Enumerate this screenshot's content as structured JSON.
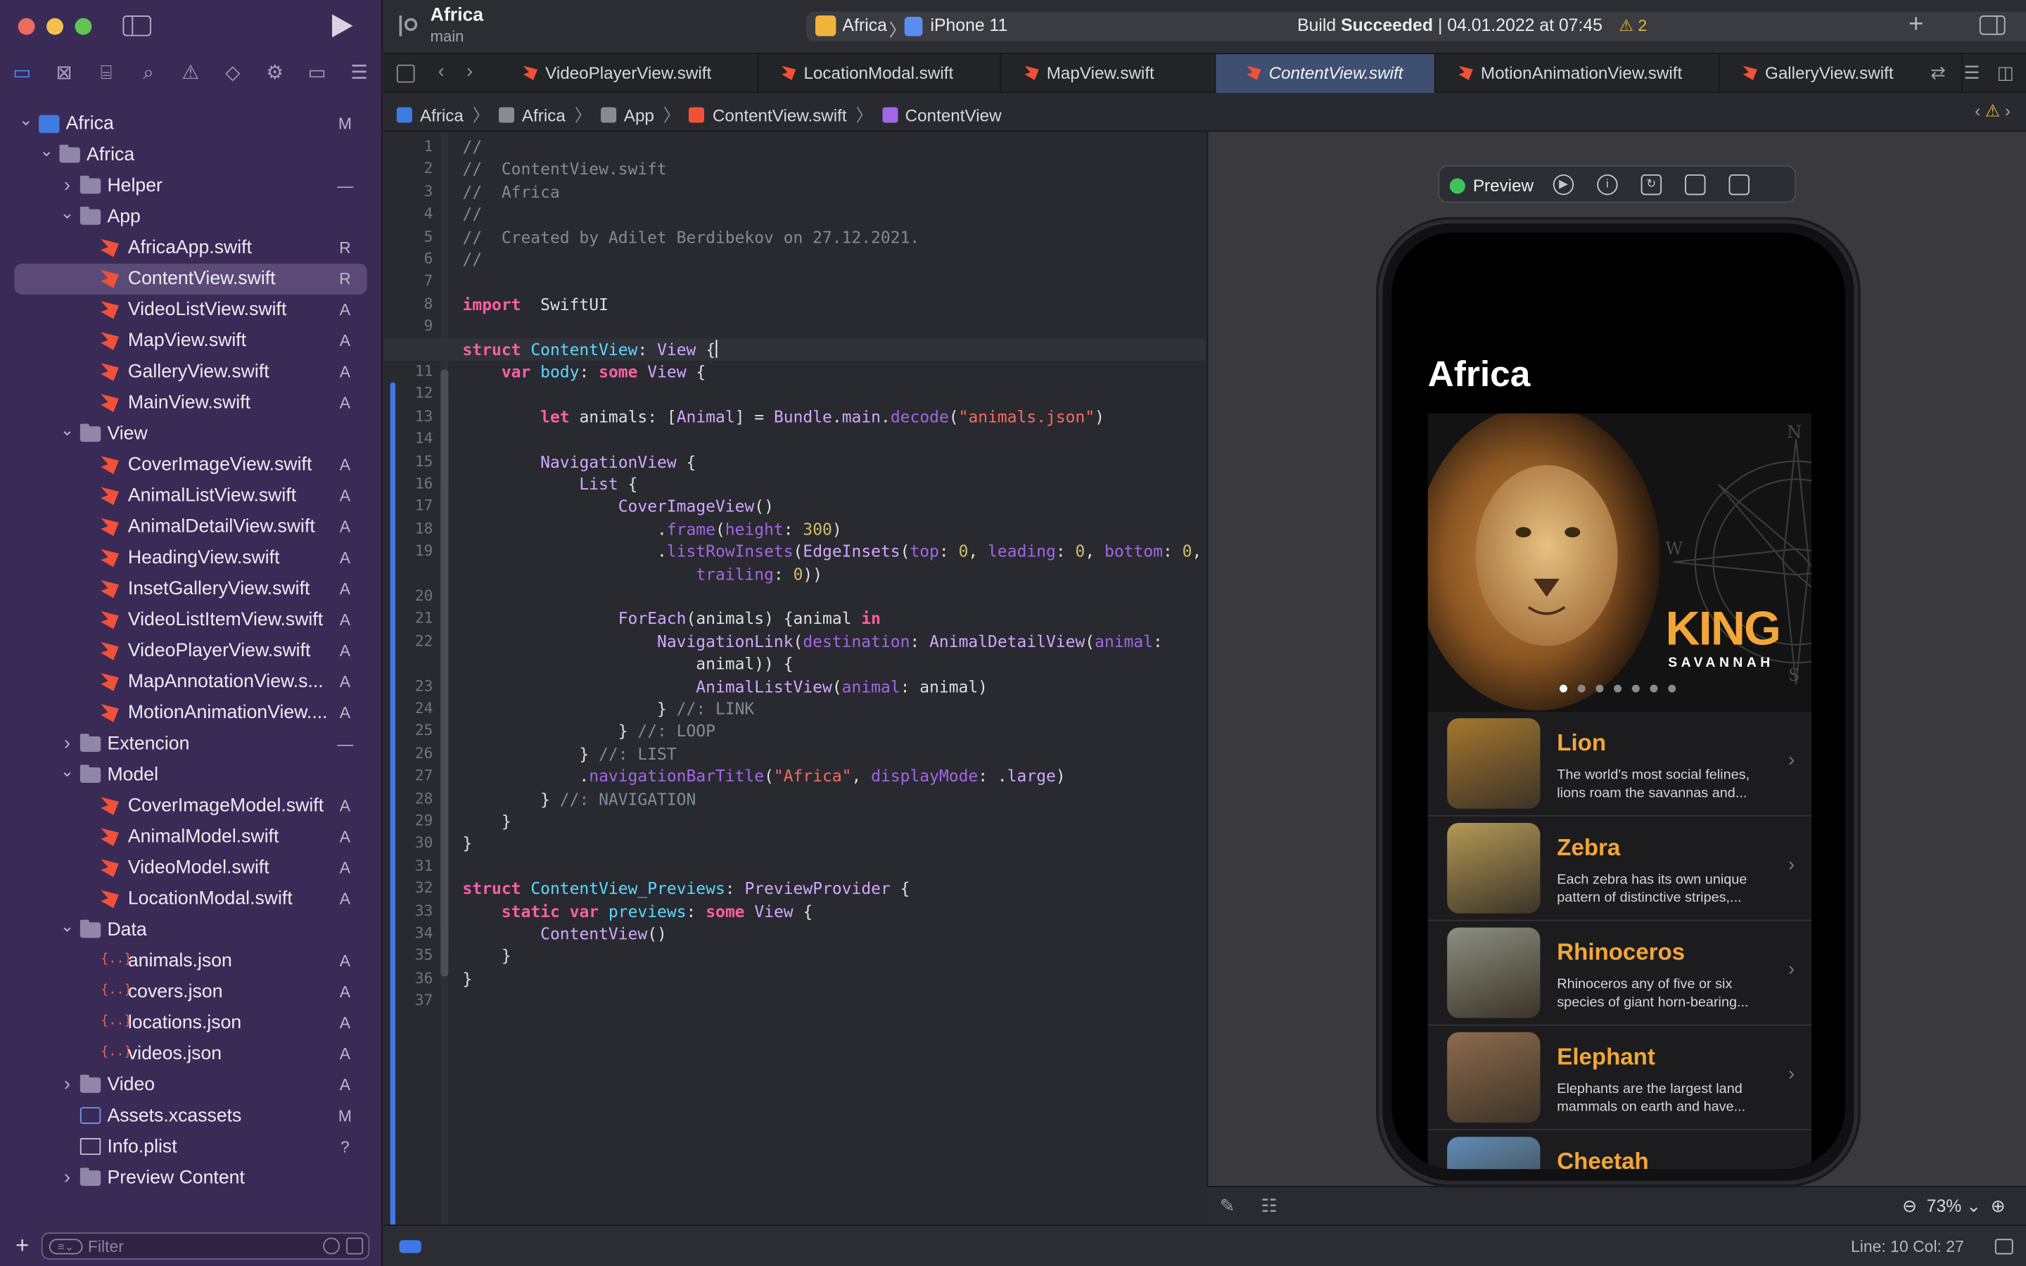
{
  "window": {
    "project_name": "Africa",
    "branch": "main",
    "scheme_app": "Africa",
    "scheme_device": "iPhone 11",
    "build_status_prefix": "Build ",
    "build_status_bold": "Succeeded",
    "build_status_suffix": " | 04.01.2022 at 07:45",
    "warning_count": "⚠ 2"
  },
  "colors": {
    "accent": "#3f77e6",
    "sidebar_bg": "#3a2a56",
    "brand_orange": "#f2a63a"
  },
  "navigator_icons": [
    "folder-icon",
    "source-control-icon",
    "symbol-icon",
    "search-icon",
    "issue-icon",
    "test-icon",
    "debug-icon",
    "breakpoint-icon",
    "report-icon"
  ],
  "sidebar": {
    "items": [
      {
        "label": "Africa",
        "badge": "M",
        "type": "proj",
        "depth": 0,
        "chev": "open"
      },
      {
        "label": "Africa",
        "badge": "",
        "type": "folder",
        "depth": 1,
        "chev": "open"
      },
      {
        "label": "Helper",
        "badge": "—",
        "type": "folder",
        "depth": 2,
        "chev": "closed"
      },
      {
        "label": "App",
        "badge": "",
        "type": "folder",
        "depth": 2,
        "chev": "open"
      },
      {
        "label": "AfricaApp.swift",
        "badge": "R",
        "type": "swift",
        "depth": 3
      },
      {
        "label": "ContentView.swift",
        "badge": "R",
        "type": "swift",
        "depth": 3,
        "selected": true
      },
      {
        "label": "VideoListView.swift",
        "badge": "A",
        "type": "swift",
        "depth": 3
      },
      {
        "label": "MapView.swift",
        "badge": "A",
        "type": "swift",
        "depth": 3
      },
      {
        "label": "GalleryView.swift",
        "badge": "A",
        "type": "swift",
        "depth": 3
      },
      {
        "label": "MainView.swift",
        "badge": "A",
        "type": "swift",
        "depth": 3
      },
      {
        "label": "View",
        "badge": "",
        "type": "folder",
        "depth": 2,
        "chev": "open"
      },
      {
        "label": "CoverImageView.swift",
        "badge": "A",
        "type": "swift",
        "depth": 3
      },
      {
        "label": "AnimalListView.swift",
        "badge": "A",
        "type": "swift",
        "depth": 3
      },
      {
        "label": "AnimalDetailView.swift",
        "badge": "A",
        "type": "swift",
        "depth": 3
      },
      {
        "label": "HeadingView.swift",
        "badge": "A",
        "type": "swift",
        "depth": 3
      },
      {
        "label": "InsetGalleryView.swift",
        "badge": "A",
        "type": "swift",
        "depth": 3
      },
      {
        "label": "VideoListItemView.swift",
        "badge": "A",
        "type": "swift",
        "depth": 3
      },
      {
        "label": "VideoPlayerView.swift",
        "badge": "A",
        "type": "swift",
        "depth": 3
      },
      {
        "label": "MapAnnotationView.s...",
        "badge": "A",
        "type": "swift",
        "depth": 3
      },
      {
        "label": "MotionAnimationView....",
        "badge": "A",
        "type": "swift",
        "depth": 3
      },
      {
        "label": "Extencion",
        "badge": "—",
        "type": "folder",
        "depth": 2,
        "chev": "closed"
      },
      {
        "label": "Model",
        "badge": "",
        "type": "folder",
        "depth": 2,
        "chev": "open"
      },
      {
        "label": "CoverImageModel.swift",
        "badge": "A",
        "type": "swift",
        "depth": 3
      },
      {
        "label": "AnimalModel.swift",
        "badge": "A",
        "type": "swift",
        "depth": 3
      },
      {
        "label": "VideoModel.swift",
        "badge": "A",
        "type": "swift",
        "depth": 3
      },
      {
        "label": "LocationModal.swift",
        "badge": "A",
        "type": "swift",
        "depth": 3
      },
      {
        "label": "Data",
        "badge": "",
        "type": "folder",
        "depth": 2,
        "chev": "open"
      },
      {
        "label": "animals.json",
        "badge": "A",
        "type": "json",
        "depth": 3
      },
      {
        "label": "covers.json",
        "badge": "A",
        "type": "json",
        "depth": 3
      },
      {
        "label": "locations.json",
        "badge": "A",
        "type": "json",
        "depth": 3
      },
      {
        "label": "videos.json",
        "badge": "A",
        "type": "json",
        "depth": 3
      },
      {
        "label": "Video",
        "badge": "A",
        "type": "folder",
        "depth": 2,
        "chev": "closed"
      },
      {
        "label": "Assets.xcassets",
        "badge": "M",
        "type": "asset",
        "depth": 2
      },
      {
        "label": "Info.plist",
        "badge": "?",
        "type": "plist",
        "depth": 2
      },
      {
        "label": "Preview Content",
        "badge": "",
        "type": "folder",
        "depth": 2,
        "chev": "closed"
      }
    ],
    "filter_placeholder": "Filter"
  },
  "tabs": [
    {
      "label": "VideoPlayerView.swift"
    },
    {
      "label": "LocationModal.swift"
    },
    {
      "label": "MapView.swift"
    },
    {
      "label": "ContentView.swift",
      "active": true
    },
    {
      "label": "MotionAnimationView.swift"
    },
    {
      "label": "GalleryView.swift"
    }
  ],
  "breadcrumb": [
    "Africa",
    "Africa",
    "App",
    "ContentView.swift",
    "ContentView"
  ],
  "editor": {
    "current_line": 10,
    "lines": [
      {
        "n": "1",
        "code": [
          [
            "cm",
            "//"
          ]
        ]
      },
      {
        "n": "2",
        "code": [
          [
            "cm",
            "//  ContentView.swift"
          ]
        ]
      },
      {
        "n": "3",
        "code": [
          [
            "cm",
            "//  Africa"
          ]
        ]
      },
      {
        "n": "4",
        "code": [
          [
            "cm",
            "//"
          ]
        ]
      },
      {
        "n": "5",
        "code": [
          [
            "cm",
            "//  Created by Adilet Berdibekov on 27.12.2021."
          ]
        ]
      },
      {
        "n": "6",
        "code": [
          [
            "cm",
            "//"
          ]
        ]
      },
      {
        "n": "7",
        "code": []
      },
      {
        "n": "8",
        "code": [
          [
            "kw",
            "import"
          ],
          [
            "",
            "  SwiftUI"
          ]
        ]
      },
      {
        "n": "9",
        "code": []
      },
      {
        "n": "10",
        "code": [
          [
            "kw",
            "struct"
          ],
          [
            "",
            " "
          ],
          [
            "tp",
            "ContentView"
          ],
          [
            "",
            ": "
          ],
          [
            "ty",
            "View"
          ],
          [
            "",
            " {"
          ]
        ],
        "cursor": true
      },
      {
        "n": "11",
        "code": [
          [
            "",
            "    "
          ],
          [
            "kw",
            "var"
          ],
          [
            "",
            " "
          ],
          [
            "tp",
            "body"
          ],
          [
            "",
            ": "
          ],
          [
            "kw",
            "some"
          ],
          [
            "",
            " "
          ],
          [
            "ty",
            "View"
          ],
          [
            "",
            " {"
          ]
        ]
      },
      {
        "n": "12",
        "code": []
      },
      {
        "n": "13",
        "code": [
          [
            "",
            "        "
          ],
          [
            "kw",
            "let"
          ],
          [
            "",
            " animals: ["
          ],
          [
            "ty",
            "Animal"
          ],
          [
            "",
            "] = "
          ],
          [
            "ty",
            "Bundle"
          ],
          [
            "",
            "."
          ],
          [
            "md",
            "main"
          ],
          [
            "",
            "."
          ],
          [
            "fn",
            "decode"
          ],
          [
            "",
            "("
          ],
          [
            "st",
            "\"animals.json\""
          ],
          [
            "",
            ")"
          ]
        ]
      },
      {
        "n": "14",
        "code": []
      },
      {
        "n": "15",
        "code": [
          [
            "",
            "        "
          ],
          [
            "ty",
            "NavigationView"
          ],
          [
            "",
            " {"
          ]
        ]
      },
      {
        "n": "16",
        "code": [
          [
            "",
            "            "
          ],
          [
            "ty",
            "List"
          ],
          [
            "",
            " {"
          ]
        ]
      },
      {
        "n": "17",
        "code": [
          [
            "",
            "                "
          ],
          [
            "ty",
            "CoverImageView"
          ],
          [
            "",
            "()"
          ]
        ]
      },
      {
        "n": "18",
        "code": [
          [
            "",
            "                    ."
          ],
          [
            "fn",
            "frame"
          ],
          [
            "",
            "("
          ],
          [
            "fn",
            "height"
          ],
          [
            "",
            ": "
          ],
          [
            "nm",
            "300"
          ],
          [
            "",
            ")"
          ]
        ]
      },
      {
        "n": "19",
        "code": [
          [
            "",
            "                    ."
          ],
          [
            "fn",
            "listRowInsets"
          ],
          [
            "",
            "("
          ],
          [
            "ty",
            "EdgeInsets"
          ],
          [
            "",
            "("
          ],
          [
            "fn",
            "top"
          ],
          [
            "",
            ": "
          ],
          [
            "nm",
            "0"
          ],
          [
            "",
            ", "
          ],
          [
            "fn",
            "leading"
          ],
          [
            "",
            ": "
          ],
          [
            "nm",
            "0"
          ],
          [
            "",
            ", "
          ],
          [
            "fn",
            "bottom"
          ],
          [
            "",
            ": "
          ],
          [
            "nm",
            "0"
          ],
          [
            "",
            ","
          ]
        ]
      },
      {
        "n": "",
        "code": [
          [
            "",
            "                        "
          ],
          [
            "fn",
            "trailing"
          ],
          [
            "",
            ": "
          ],
          [
            "nm",
            "0"
          ],
          [
            "",
            "))"
          ]
        ]
      },
      {
        "n": "20",
        "code": []
      },
      {
        "n": "21",
        "code": [
          [
            "",
            "                "
          ],
          [
            "ty",
            "ForEach"
          ],
          [
            "",
            "(animals) {animal "
          ],
          [
            "kw",
            "in"
          ]
        ]
      },
      {
        "n": "22",
        "code": [
          [
            "",
            "                    "
          ],
          [
            "ty",
            "NavigationLink"
          ],
          [
            "",
            "("
          ],
          [
            "fn",
            "destination"
          ],
          [
            "",
            ": "
          ],
          [
            "ty",
            "AnimalDetailView"
          ],
          [
            "",
            "("
          ],
          [
            "fn",
            "animal"
          ],
          [
            "",
            ":"
          ]
        ]
      },
      {
        "n": "",
        "code": [
          [
            "",
            "                        animal)) {"
          ]
        ]
      },
      {
        "n": "23",
        "code": [
          [
            "",
            "                        "
          ],
          [
            "ty",
            "AnimalListView"
          ],
          [
            "",
            "("
          ],
          [
            "fn",
            "animal"
          ],
          [
            "",
            ": animal)"
          ]
        ]
      },
      {
        "n": "24",
        "code": [
          [
            "",
            "                    } "
          ],
          [
            "cm",
            "//: LINK"
          ]
        ]
      },
      {
        "n": "25",
        "code": [
          [
            "",
            "                } "
          ],
          [
            "cm",
            "//: LOOP"
          ]
        ]
      },
      {
        "n": "26",
        "code": [
          [
            "",
            "            } "
          ],
          [
            "cm",
            "//: LIST"
          ]
        ]
      },
      {
        "n": "27",
        "code": [
          [
            "",
            "            ."
          ],
          [
            "fn",
            "navigationBarTitle"
          ],
          [
            "",
            "("
          ],
          [
            "st",
            "\"Africa\""
          ],
          [
            "",
            ", "
          ],
          [
            "fn",
            "displayMode"
          ],
          [
            "",
            ": ."
          ],
          [
            "md",
            "large"
          ],
          [
            "",
            ")"
          ]
        ]
      },
      {
        "n": "28",
        "code": [
          [
            "",
            "        } "
          ],
          [
            "cm",
            "//: NAVIGATION"
          ]
        ]
      },
      {
        "n": "29",
        "code": [
          [
            "",
            "    }"
          ]
        ]
      },
      {
        "n": "30",
        "code": [
          [
            "",
            "}"
          ]
        ]
      },
      {
        "n": "31",
        "code": []
      },
      {
        "n": "32",
        "code": [
          [
            "kw",
            "struct"
          ],
          [
            "",
            " "
          ],
          [
            "tp",
            "ContentView_Previews"
          ],
          [
            "",
            ": "
          ],
          [
            "ty",
            "PreviewProvider"
          ],
          [
            "",
            " {"
          ]
        ]
      },
      {
        "n": "33",
        "code": [
          [
            "",
            "    "
          ],
          [
            "kw",
            "static"
          ],
          [
            "",
            " "
          ],
          [
            "kw",
            "var"
          ],
          [
            "",
            " "
          ],
          [
            "tp",
            "previews"
          ],
          [
            "",
            ": "
          ],
          [
            "kw",
            "some"
          ],
          [
            "",
            " "
          ],
          [
            "ty",
            "View"
          ],
          [
            "",
            " {"
          ]
        ]
      },
      {
        "n": "34",
        "code": [
          [
            "",
            "        "
          ],
          [
            "ty",
            "ContentView"
          ],
          [
            "",
            "()"
          ]
        ]
      },
      {
        "n": "35",
        "code": [
          [
            "",
            "    }"
          ]
        ]
      },
      {
        "n": "36",
        "code": [
          [
            "",
            "}"
          ]
        ]
      },
      {
        "n": "37",
        "code": []
      }
    ]
  },
  "preview": {
    "label": "Preview",
    "nav_title": "Africa",
    "cover_title": "KING",
    "cover_subtitle": "SAVANNAH",
    "compass_letters": {
      "n": "N",
      "w": "W",
      "s": "S"
    },
    "page_dots": 7,
    "animals": [
      {
        "name": "Lion",
        "desc": "The world's most social felines, lions roam the savannas and...",
        "color": "#a5772e"
      },
      {
        "name": "Zebra",
        "desc": "Each zebra has its own unique pattern of distinctive stripes,...",
        "color": "#b49a55"
      },
      {
        "name": "Rhinoceros",
        "desc": "Rhinoceros any of five or six species of giant horn-bearing...",
        "color": "#8b8f82"
      },
      {
        "name": "Elephant",
        "desc": "Elephants are the largest land mammals on earth and have...",
        "color": "#8d6b4c"
      },
      {
        "name": "Cheetah",
        "desc": "",
        "color": "#5e8dba"
      }
    ],
    "zoom": "73%"
  },
  "status": {
    "position": "Line: 10  Col: 27"
  }
}
